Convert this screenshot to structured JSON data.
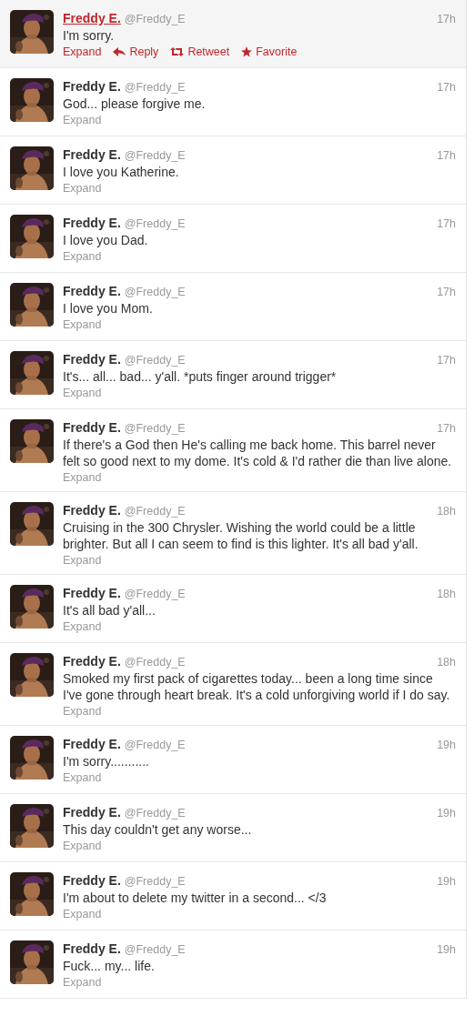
{
  "tweets": [
    {
      "name": "Freddy E.",
      "handle": "@Freddy_E",
      "time": "17h",
      "text": "I'm sorry.",
      "expand": "Expand",
      "hovered": true,
      "actions": [
        {
          "kind": "reply",
          "label": "Reply"
        },
        {
          "kind": "retweet",
          "label": "Retweet"
        },
        {
          "kind": "favorite",
          "label": "Favorite"
        }
      ]
    },
    {
      "name": "Freddy E.",
      "handle": "@Freddy_E",
      "time": "17h",
      "text": "God... please forgive me.",
      "expand": "Expand",
      "hovered": false
    },
    {
      "name": "Freddy E.",
      "handle": "@Freddy_E",
      "time": "17h",
      "text": "I love you Katherine.",
      "expand": "Expand",
      "hovered": false
    },
    {
      "name": "Freddy E.",
      "handle": "@Freddy_E",
      "time": "17h",
      "text": "I love you Dad.",
      "expand": "Expand",
      "hovered": false
    },
    {
      "name": "Freddy E.",
      "handle": "@Freddy_E",
      "time": "17h",
      "text": "I love you Mom.",
      "expand": "Expand",
      "hovered": false
    },
    {
      "name": "Freddy E.",
      "handle": "@Freddy_E",
      "time": "17h",
      "text": "It's... all... bad... y'all. *puts finger around trigger*",
      "expand": "Expand",
      "hovered": false
    },
    {
      "name": "Freddy E.",
      "handle": "@Freddy_E",
      "time": "17h",
      "text": "If there's a God then He's calling me back home. This barrel never felt so good next to my dome. It's cold & I'd rather die than live alone.",
      "expand": "Expand",
      "hovered": false
    },
    {
      "name": "Freddy E.",
      "handle": "@Freddy_E",
      "time": "18h",
      "text": "Cruising in the 300 Chrysler. Wishing the world could be a little brighter. But all I can seem to find is this lighter. It's all bad y'all.",
      "expand": "Expand",
      "hovered": false
    },
    {
      "name": "Freddy E.",
      "handle": "@Freddy_E",
      "time": "18h",
      "text": "It's all bad y'all...",
      "expand": "Expand",
      "hovered": false
    },
    {
      "name": "Freddy E.",
      "handle": "@Freddy_E",
      "time": "18h",
      "text": "Smoked my first pack of cigarettes today... been a long time since I've gone through heart break. It's a cold unforgiving world if I do say.",
      "expand": "Expand",
      "hovered": false
    },
    {
      "name": "Freddy E.",
      "handle": "@Freddy_E",
      "time": "19h",
      "text": "I'm sorry...........",
      "expand": "Expand",
      "hovered": false
    },
    {
      "name": "Freddy E.",
      "handle": "@Freddy_E",
      "time": "19h",
      "text": "This day couldn't get any worse...",
      "expand": "Expand",
      "hovered": false
    },
    {
      "name": "Freddy E.",
      "handle": "@Freddy_E",
      "time": "19h",
      "text": "I'm about to delete my twitter in a second... </3",
      "expand": "Expand",
      "hovered": false
    },
    {
      "name": "Freddy E.",
      "handle": "@Freddy_E",
      "time": "19h",
      "text": "Fuck... my... life.",
      "expand": "Expand",
      "hovered": false
    }
  ]
}
